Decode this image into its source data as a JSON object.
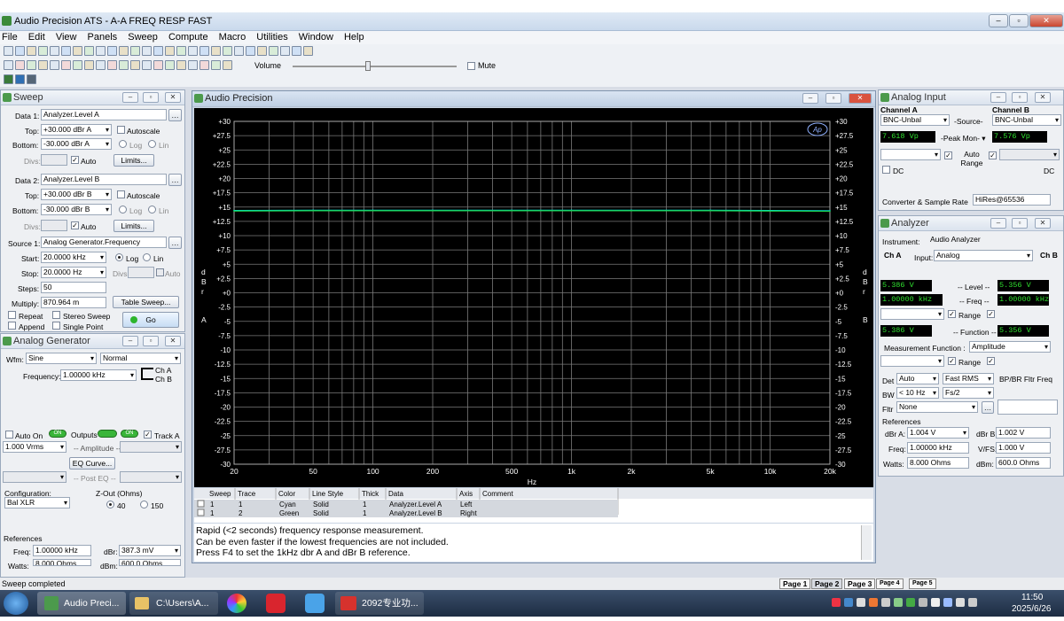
{
  "app": {
    "title": "Audio Precision ATS - A-A FREQ RESP FAST"
  },
  "menu": [
    "File",
    "Edit",
    "View",
    "Panels",
    "Sweep",
    "Compute",
    "Macro",
    "Utilities",
    "Window",
    "Help"
  ],
  "toolbar": {
    "volume_label": "Volume",
    "mute_label": "Mute",
    "mute_checked": false
  },
  "sweep": {
    "title": "Sweep",
    "data1": {
      "label": "Data 1:",
      "value": "Analyzer.Level A",
      "top_label": "Top:",
      "top": "+30.000  dBr A",
      "bottom_label": "Bottom:",
      "bottom": "-30.000  dBr A",
      "autoscale": "Autoscale",
      "log": "Log",
      "lin": "Lin",
      "divs_label": "Divs:",
      "auto": "Auto",
      "limits": "Limits..."
    },
    "data2": {
      "label": "Data 2:",
      "value": "Analyzer.Level B",
      "top_label": "Top:",
      "top": "+30.000  dBr B",
      "bottom_label": "Bottom:",
      "bottom": "-30.000  dBr B",
      "autoscale": "Autoscale",
      "log": "Log",
      "lin": "Lin",
      "divs_label": "Divs:",
      "auto": "Auto",
      "limits": "Limits..."
    },
    "source1": {
      "label": "Source 1:",
      "value": "Analog Generator.Frequency",
      "start_label": "Start:",
      "start": "20.0000  kHz",
      "stop_label": "Stop:",
      "stop": "20.0000  Hz",
      "log": "Log",
      "lin": "Lin",
      "divs_label": "Divs:",
      "auto": "Auto"
    },
    "steps_label": "Steps:",
    "steps": "50",
    "multiply_label": "Multiply:",
    "multiply": "870.964  m",
    "table_sweep": "Table Sweep...",
    "repeat": "Repeat",
    "append": "Append",
    "stereo_sweep": "Stereo Sweep",
    "single_point": "Single Point",
    "go": "Go"
  },
  "generator": {
    "title": "Analog Generator",
    "wfm_label": "Wfm:",
    "wfm": "Sine",
    "wfm2": "Normal",
    "freq_label": "Frequency:",
    "freq": "1.00000  kHz",
    "cha": "Ch A",
    "chb": "Ch B",
    "auto_on": "Auto On",
    "on_label": "ON",
    "outputs": "Outputs",
    "track_a": "Track A",
    "amplitude": "1.000     Vrms",
    "amplitude_label": "-- Amplitude --",
    "eq_curve": "EQ Curve...",
    "post_eq": "-- Post EQ --",
    "config_label": "Configuration:",
    "config": "Bal XLR",
    "zout_label": "Z-Out (Ohms)",
    "z40": "40",
    "z150": "150",
    "refs_label": "References",
    "ref_freq_label": "Freq:",
    "ref_freq": "1.00000 kHz",
    "dbr_label": "dBr:",
    "dbr": "387.3   mV",
    "watts_label": "Watts:",
    "watts": "8.000    Ohms",
    "dbm_label": "dBm:",
    "dbm": "600.0    Ohms"
  },
  "graph": {
    "title": "Audio Precision",
    "badge": "Ap",
    "y_axis_letters_left": [
      "d",
      "B",
      "r",
      "",
      "A"
    ],
    "y_axis_letters_right": [
      "d",
      "B",
      "r",
      "",
      "B"
    ],
    "x_unit": "Hz"
  },
  "chart_data": {
    "type": "line",
    "xscale": "log",
    "xlim": [
      20,
      20000
    ],
    "ylim": [
      -30,
      30
    ],
    "x_ticks": [
      20,
      50,
      100,
      200,
      500,
      1000,
      2000,
      5000,
      10000,
      20000
    ],
    "x_tick_labels": [
      "20",
      "50",
      "100",
      "200",
      "500",
      "1k",
      "2k",
      "5k",
      "10k",
      "20k"
    ],
    "y_tick_labels": [
      "+30",
      "+27.5",
      "+25",
      "+22.5",
      "+20",
      "+17.5",
      "+15",
      "+12.5",
      "+10",
      "+7.5",
      "+5",
      "+2.5",
      "+0",
      "-2.5",
      "-5",
      "-7.5",
      "-10",
      "-12.5",
      "-15",
      "-17.5",
      "-20",
      "-22.5",
      "-25",
      "-27.5",
      "-30"
    ],
    "grid": true,
    "xlabel": "Hz",
    "series": [
      {
        "name": "Analyzer.Level A",
        "color": "#00e6e6",
        "x": [
          20,
          50,
          100,
          200,
          500,
          1000,
          2000,
          5000,
          10000,
          20000
        ],
        "y": [
          14.4,
          14.45,
          14.45,
          14.45,
          14.45,
          14.45,
          14.45,
          14.45,
          14.4,
          14.35
        ]
      },
      {
        "name": "Analyzer.Level B",
        "color": "#1fcf4a",
        "x": [
          20,
          50,
          100,
          200,
          500,
          1000,
          2000,
          5000,
          10000,
          20000
        ],
        "y": [
          14.4,
          14.45,
          14.45,
          14.45,
          14.45,
          14.45,
          14.45,
          14.45,
          14.4,
          14.35
        ]
      }
    ]
  },
  "legend": {
    "headers": [
      "Sweep",
      "Trace",
      "Color",
      "Line Style",
      "Thick",
      "Data",
      "Axis",
      "Comment"
    ],
    "rows": [
      {
        "sweep": "1",
        "trace": "1",
        "color": "Cyan",
        "style": "Solid",
        "thick": "1",
        "data": "Analyzer.Level A",
        "axis": "Left"
      },
      {
        "sweep": "1",
        "trace": "2",
        "color": "Green",
        "style": "Solid",
        "thick": "1",
        "data": "Analyzer.Level B",
        "axis": "Right"
      }
    ]
  },
  "note": [
    "Rapid (<2 seconds) frequency response measurement.",
    "Can be even faster if the lowest frequencies are not included.",
    "Press F4 to set the 1kHz dbr A and dBr B reference."
  ],
  "analog_input": {
    "title": "Analog Input",
    "cha": "Channel A",
    "chb": "Channel B",
    "src_a": "BNC-Unbal",
    "src_label": "-Source-",
    "src_b": "BNC-Unbal",
    "peak_a": "7.618    Vp",
    "peak_label": "-Peak Mon-",
    "peak_b": "7.576    Vp",
    "auto_range": "Auto Range",
    "dc": "DC",
    "conv_label": "Converter & Sample Rate",
    "conv": "HiRes@65536"
  },
  "analyzer": {
    "title": "Analyzer",
    "instr_label": "Instrument:",
    "instr": "Audio Analyzer",
    "cha": "Ch A",
    "input_label": "Input:",
    "input": "Analog",
    "chb": "Ch B",
    "level_a": "5.386    V",
    "level_label": "-- Level --",
    "level_b": "5.356    V",
    "freq_a": "1.00000 kHz",
    "freq_label": "-- Freq --",
    "freq_b": "1.00000 kHz",
    "range": "Range",
    "func_a": "5.386    V",
    "func_label": "-- Function --",
    "func_b": "5.356    V",
    "meas_label": "Measurement Function :",
    "meas": "Amplitude",
    "det_label": "Det",
    "det": "Auto",
    "det2": "Fast RMS",
    "bpbr": "BP/BR Fltr Freq",
    "bw_label": "BW",
    "bw": "< 10 Hz",
    "bw2": "Fs/2",
    "fltr_label": "Fltr",
    "fltr": "None",
    "refs_label": "References",
    "dbra_label": "dBr A:",
    "dbra": "1.004     V",
    "dbrb_label": "dBr B:",
    "dbrb": "1.002     V",
    "freq_ref_label": "Freq:",
    "freq_ref": "1.00000 kHz",
    "vfs_label": "V/FS:",
    "vfs": "1.000     V",
    "watts_label": "Watts:",
    "watts": "8.000     Ohms",
    "dbm_label": "dBm:",
    "dbm": "600.0     Ohms"
  },
  "status": {
    "text": "Sweep completed",
    "pages": [
      "Page 1",
      "Page 2",
      "Page 3",
      "Page 4",
      "Page 5"
    ]
  },
  "taskbar": {
    "items": [
      "Audio Preci...",
      "C:\\Users\\A...",
      "2092专业功..."
    ],
    "time": "11:50",
    "date": "2025/6/26"
  }
}
